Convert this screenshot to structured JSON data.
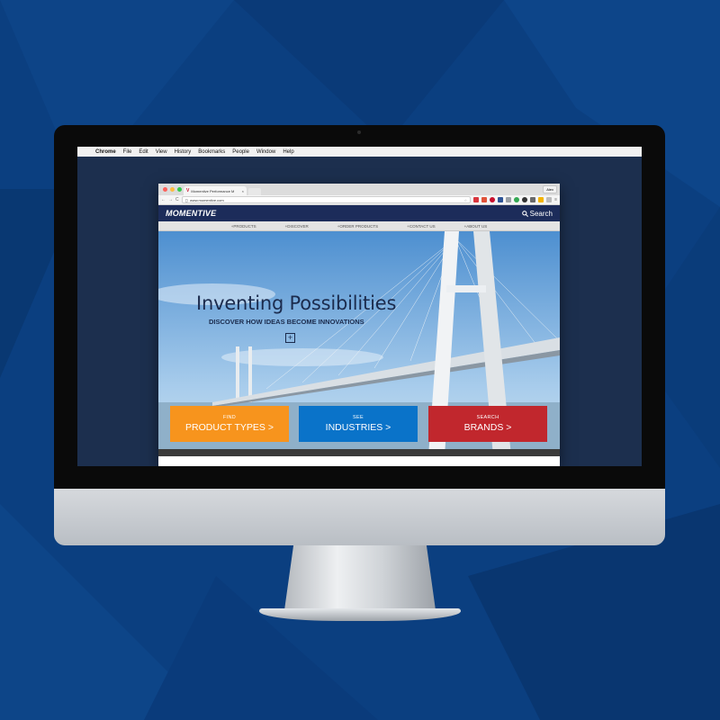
{
  "mac_menubar": {
    "app": "Chrome",
    "items": [
      "File",
      "Edit",
      "View",
      "History",
      "Bookmarks",
      "People",
      "Window",
      "Help"
    ]
  },
  "browser": {
    "tab_title": "Momentive Performance M",
    "tab_close": "×",
    "profile": "Alex",
    "url": "www.momentive.com",
    "back": "←",
    "forward": "→",
    "reload": "C",
    "star": "☆"
  },
  "site": {
    "logo": "MOMENTIVE",
    "search_label": "Search",
    "nav": [
      "+PRODUCTS",
      "+DISCOVER",
      "+ORDER PRODUCTS",
      "+CONTACT US",
      "+ABOUT US"
    ],
    "hero": {
      "title": "Inventing Possibilities",
      "subtitle": "DISCOVER HOW IDEAS BECOME INNOVATIONS",
      "plus": "+"
    },
    "cta": [
      {
        "small": "FIND",
        "big": "PRODUCT TYPES >"
      },
      {
        "small": "SEE",
        "big": "INDUSTRIES >"
      },
      {
        "small": "SEARCH",
        "big": "BRANDS >"
      }
    ]
  },
  "colors": {
    "background": "#0b3f80",
    "header": "#1c2c5a",
    "cta_orange": "#f7941d",
    "cta_blue": "#0a73c9",
    "cta_red": "#c1272d"
  },
  "icons": {
    "apple": "",
    "search": "search-icon"
  }
}
